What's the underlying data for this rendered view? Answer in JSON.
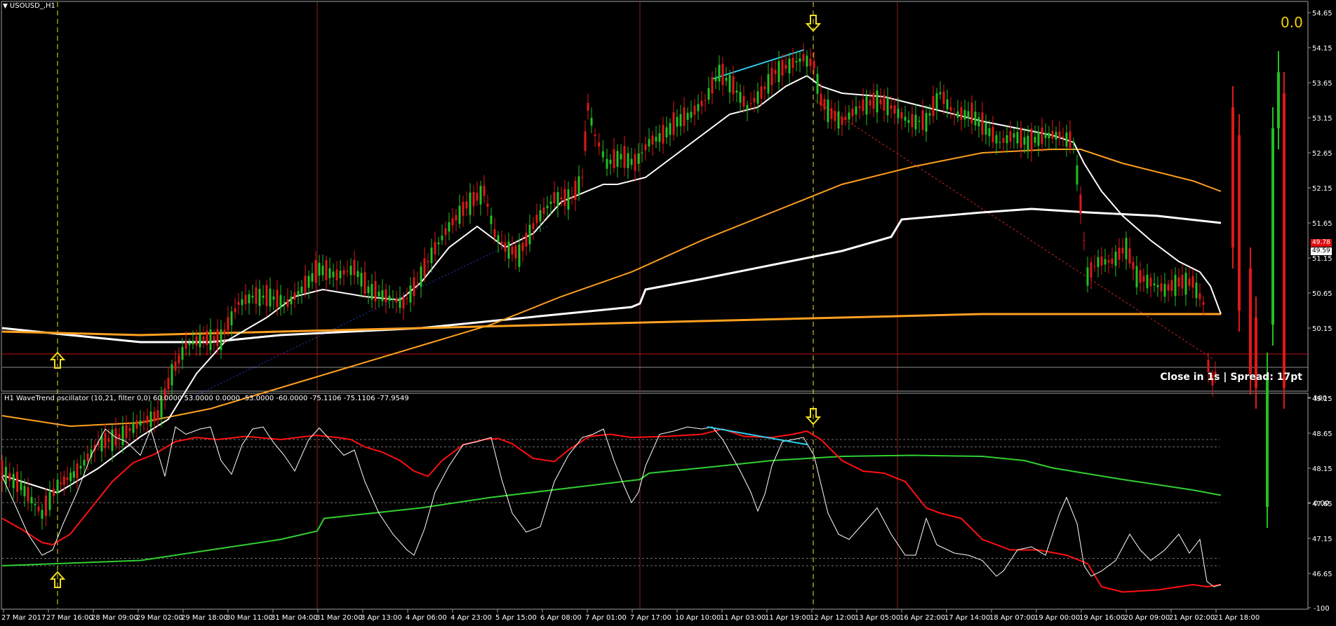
{
  "window": {
    "title": "USOUSD_,H1"
  },
  "indicator": {
    "label": "H1 WaveTrend oscillator (10,21, filter 0,0) 60.0000 53.0000 0.0000 -53.0000 -60.0000 -75.1106 -75.1106 -77.9549"
  },
  "status": {
    "counter": "0.0",
    "close_info": "Close in 1s | Spread: 17pt"
  },
  "price_tags": {
    "red": "49.78",
    "white": "49.59"
  },
  "price_axis": [
    "54.65",
    "54.15",
    "53.65",
    "53.15",
    "52.65",
    "52.15",
    "51.65",
    "51.15",
    "50.65",
    "50.15",
    "49.15",
    "48.65",
    "48.15",
    "47.65",
    "47.15",
    "46.65"
  ],
  "osc_axis": [
    "100",
    "0.00",
    "-100"
  ],
  "time_axis": [
    "27 Mar 2017",
    "27 Mar 16:00",
    "28 Mar 09:00",
    "29 Mar 02:00",
    "29 Mar 18:00",
    "30 Mar 11:00",
    "31 Mar 04:00",
    "31 Mar 20:00",
    "3 Apr 13:00",
    "4 Apr 06:00",
    "4 Apr 23:00",
    "5 Apr 15:00",
    "6 Apr 08:00",
    "7 Apr 01:00",
    "7 Apr 17:00",
    "10 Apr 10:00",
    "11 Apr 03:00",
    "11 Apr 19:00",
    "12 Apr 12:00",
    "13 Apr 05:00",
    "16 Apr 22:00",
    "17 Apr 14:00",
    "18 Apr 07:00",
    "19 Apr 00:00",
    "19 Apr 16:00",
    "20 Apr 09:00",
    "21 Apr 02:00",
    "21 Apr 18:00"
  ],
  "colors": {
    "bull": "#22c022",
    "bear": "#e01818",
    "ma_white": "#ffffff",
    "ma_orange": "#ffa020",
    "arrow": "#f0e020",
    "cyan": "#30d0f0",
    "wt_fast": "#ffffff",
    "wt_slow": "#ff1010",
    "wt_trend": "#30d030"
  }
}
